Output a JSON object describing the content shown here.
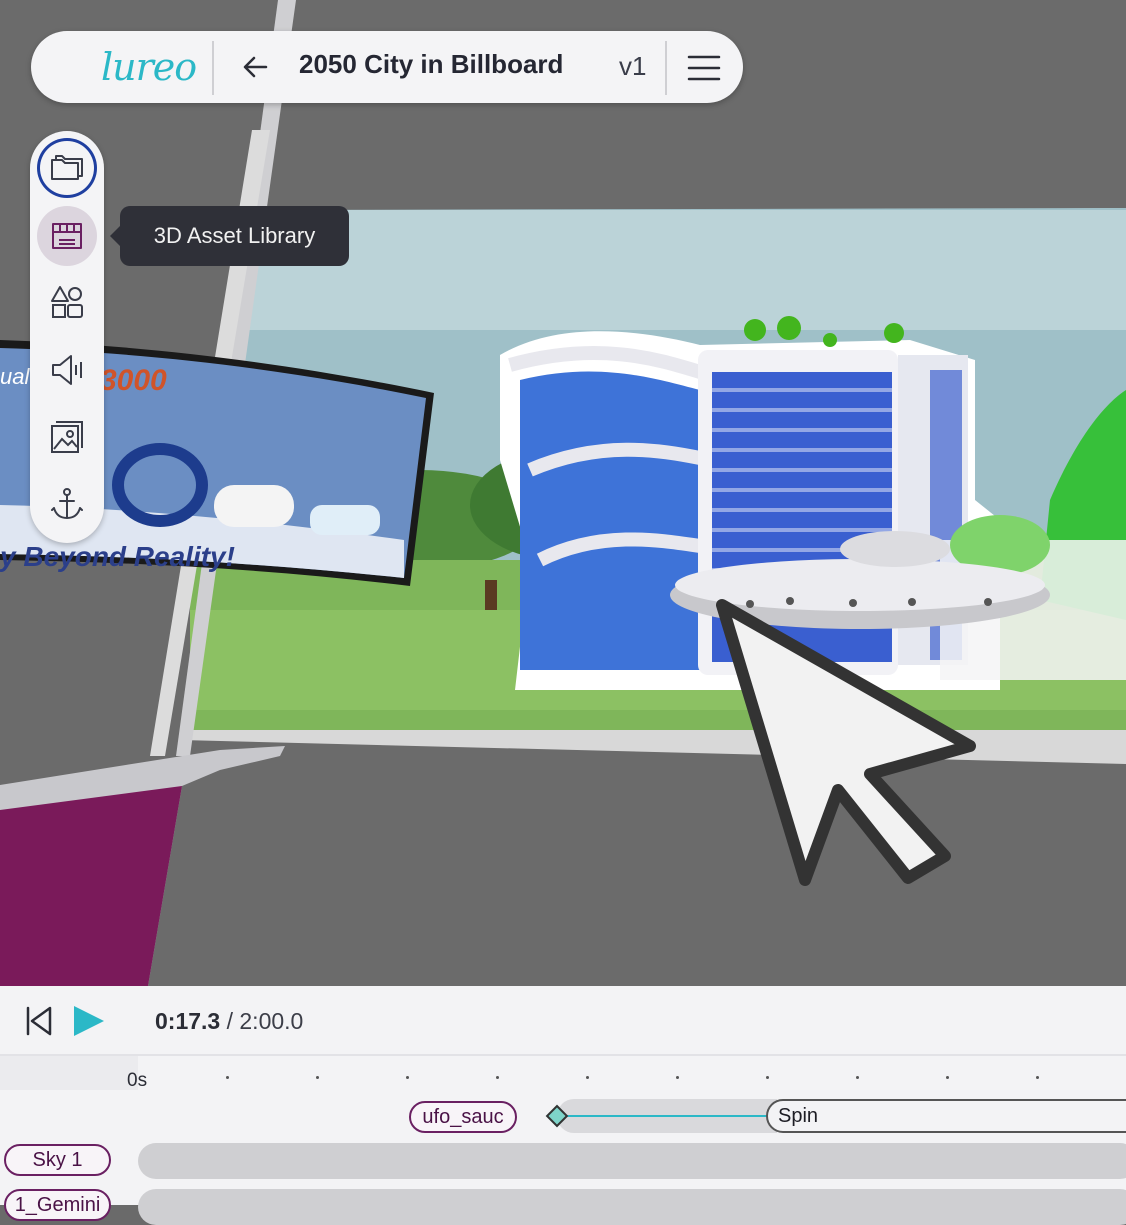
{
  "app": {
    "logo": "lureo"
  },
  "header": {
    "title": "2050 City in Billboard",
    "version": "v1"
  },
  "toolbar": {
    "tools": [
      {
        "name": "folder-icon",
        "state": "selected"
      },
      {
        "name": "store-icon",
        "state": "hover"
      },
      {
        "name": "shapes-icon"
      },
      {
        "name": "speaker-icon"
      },
      {
        "name": "image-icon"
      },
      {
        "name": "anchor-icon"
      }
    ],
    "tooltip": "3D Asset Library"
  },
  "scene": {
    "billboard_left": {
      "line1": "ual",
      "line1b": "3000",
      "line2": "y Beyond Reality!"
    }
  },
  "timeline": {
    "current": "0:17.3",
    "separator": " / ",
    "total": "2:00.0",
    "ruler_start": "0s",
    "clip_label": "ufo_sauc",
    "animation_label": "Spin",
    "tracks": [
      "Sky 1",
      "1_Gemini"
    ]
  },
  "colors": {
    "accent": "#2bb8c7",
    "selected": "#1f3fa0",
    "chip_border": "#6a2062",
    "magenta_panel": "#7a1a5a"
  }
}
